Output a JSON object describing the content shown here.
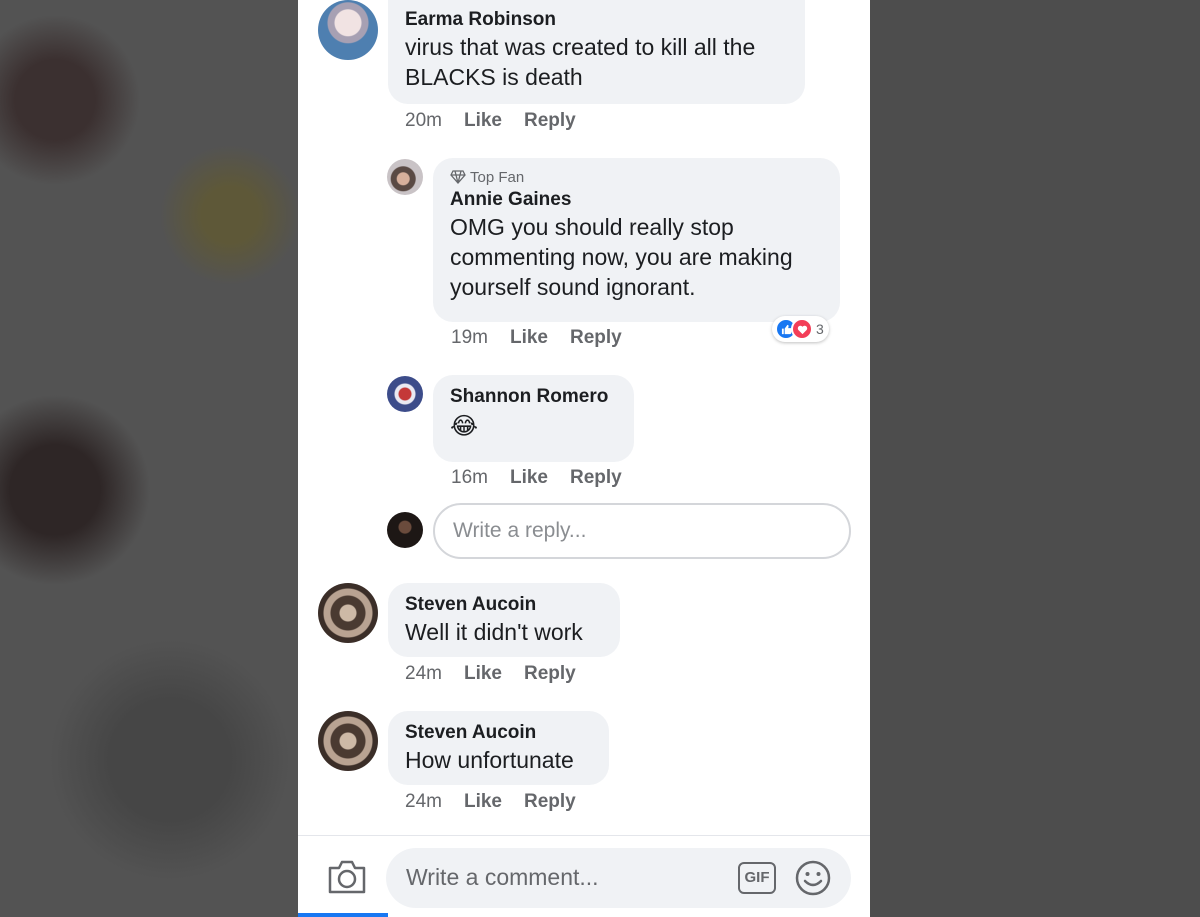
{
  "comments": [
    {
      "author": "Earma Robinson",
      "text": "virus that was created to kill all the BLACKS is death",
      "time": "20m",
      "like_label": "Like",
      "reply_label": "Reply"
    },
    {
      "badge": "Top Fan",
      "author": "Annie Gaines",
      "text": "OMG you should really stop commenting now, you are making yourself sound ignorant.",
      "time": "19m",
      "like_label": "Like",
      "reply_label": "Reply",
      "reaction_count": "3"
    },
    {
      "author": "Shannon Romero",
      "text": "😂",
      "time": "16m",
      "like_label": "Like",
      "reply_label": "Reply"
    },
    {
      "author": "Steven Aucoin",
      "text": "Well it didn't work",
      "time": "24m",
      "like_label": "Like",
      "reply_label": "Reply"
    },
    {
      "author": "Steven Aucoin",
      "text": "How unfortunate",
      "time": "24m",
      "like_label": "Like",
      "reply_label": "Reply"
    }
  ],
  "reply_box": {
    "placeholder": "Write a reply..."
  },
  "comment_bar": {
    "placeholder": "Write a comment...",
    "gif_label": "GIF"
  },
  "icons": [
    "diamond-icon",
    "like-reaction-icon",
    "love-reaction-icon",
    "camera-icon",
    "gif-icon",
    "smiley-icon"
  ],
  "colors": {
    "accent": "#1877f2",
    "bubble": "#f0f2f5",
    "love": "#f33e58"
  }
}
